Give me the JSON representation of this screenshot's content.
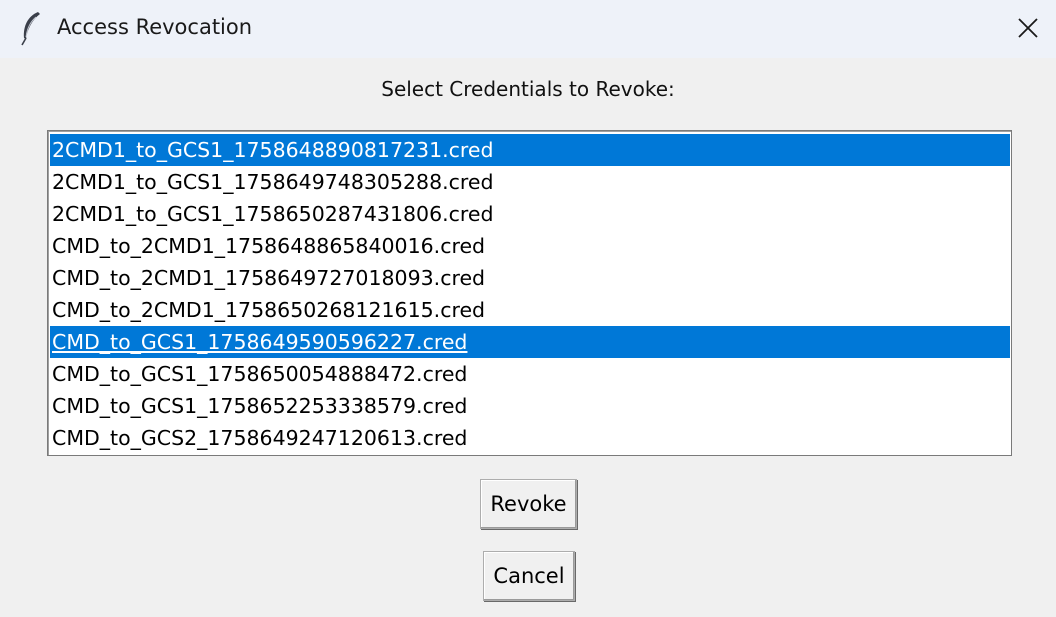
{
  "window": {
    "title": "Access Revocation"
  },
  "prompt": "Select Credentials to Revoke:",
  "credentials": [
    {
      "label": "2CMD1_to_GCS1_1758648890817231.cred",
      "selected": true,
      "active": false
    },
    {
      "label": "2CMD1_to_GCS1_1758649748305288.cred",
      "selected": false,
      "active": false
    },
    {
      "label": "2CMD1_to_GCS1_1758650287431806.cred",
      "selected": false,
      "active": false
    },
    {
      "label": "CMD_to_2CMD1_1758648865840016.cred",
      "selected": false,
      "active": false
    },
    {
      "label": "CMD_to_2CMD1_1758649727018093.cred",
      "selected": false,
      "active": false
    },
    {
      "label": "CMD_to_2CMD1_1758650268121615.cred",
      "selected": false,
      "active": false
    },
    {
      "label": "CMD_to_GCS1_1758649590596227.cred",
      "selected": true,
      "active": true
    },
    {
      "label": "CMD_to_GCS1_1758650054888472.cred",
      "selected": false,
      "active": false
    },
    {
      "label": "CMD_to_GCS1_1758652253338579.cred",
      "selected": false,
      "active": false
    },
    {
      "label": "CMD_to_GCS2_1758649247120613.cred",
      "selected": false,
      "active": false
    }
  ],
  "buttons": {
    "revoke": "Revoke",
    "cancel": "Cancel"
  },
  "icons": {
    "app": "feather-icon",
    "close": "close-icon"
  },
  "colors": {
    "selection": "#0078d7",
    "titlebar": "#eef2f9",
    "background": "#f0f0f0"
  }
}
